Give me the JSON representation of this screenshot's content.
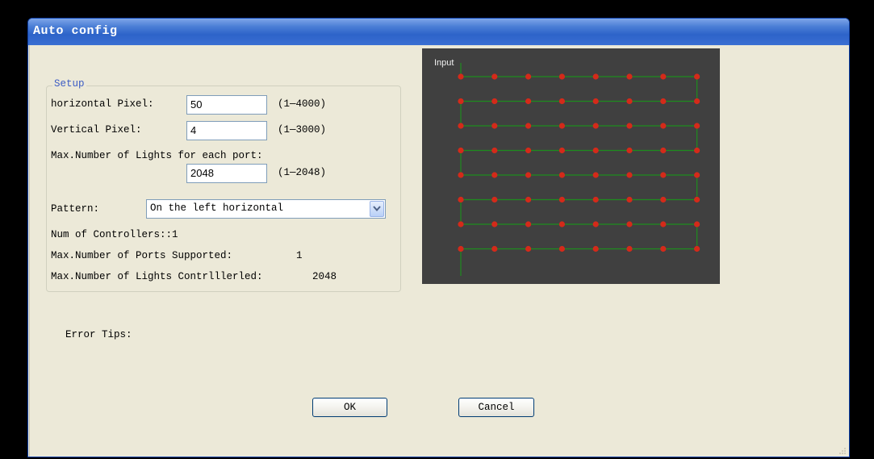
{
  "window": {
    "title": "Auto config"
  },
  "setup": {
    "group_title": "Setup",
    "horizontal_label": "horizontal Pixel:",
    "horizontal_value": "50",
    "horizontal_range": "(1—4000)",
    "vertical_label": "Vertical Pixel:",
    "vertical_value": "4",
    "vertical_range": "(1—3000)",
    "max_lights_label": "Max.Number of Lights for each port:",
    "max_lights_value": "2048",
    "max_lights_range": "(1—2048)",
    "pattern_label": "Pattern:",
    "pattern_value": "On the left horizontal",
    "controllers_text": "Num of Controllers::1",
    "ports_label": "Max.Number of Ports Supported:",
    "ports_value": "1",
    "lights_controlled_label": "Max.Number of Lights Contrlllerled:",
    "lights_controlled_value": "2048"
  },
  "preview": {
    "label": "Input",
    "rows": 8,
    "cols": 8,
    "dot_color": "#d42a1a",
    "line_color": "#1e8c1e",
    "background": "#404040"
  },
  "error": {
    "label": "Error Tips:"
  },
  "buttons": {
    "ok": "OK",
    "cancel": "Cancel"
  },
  "colors": {
    "titlebar": "#2d63c9",
    "dialog_bg": "#ece9d8",
    "group_title": "#3c5cc4"
  }
}
